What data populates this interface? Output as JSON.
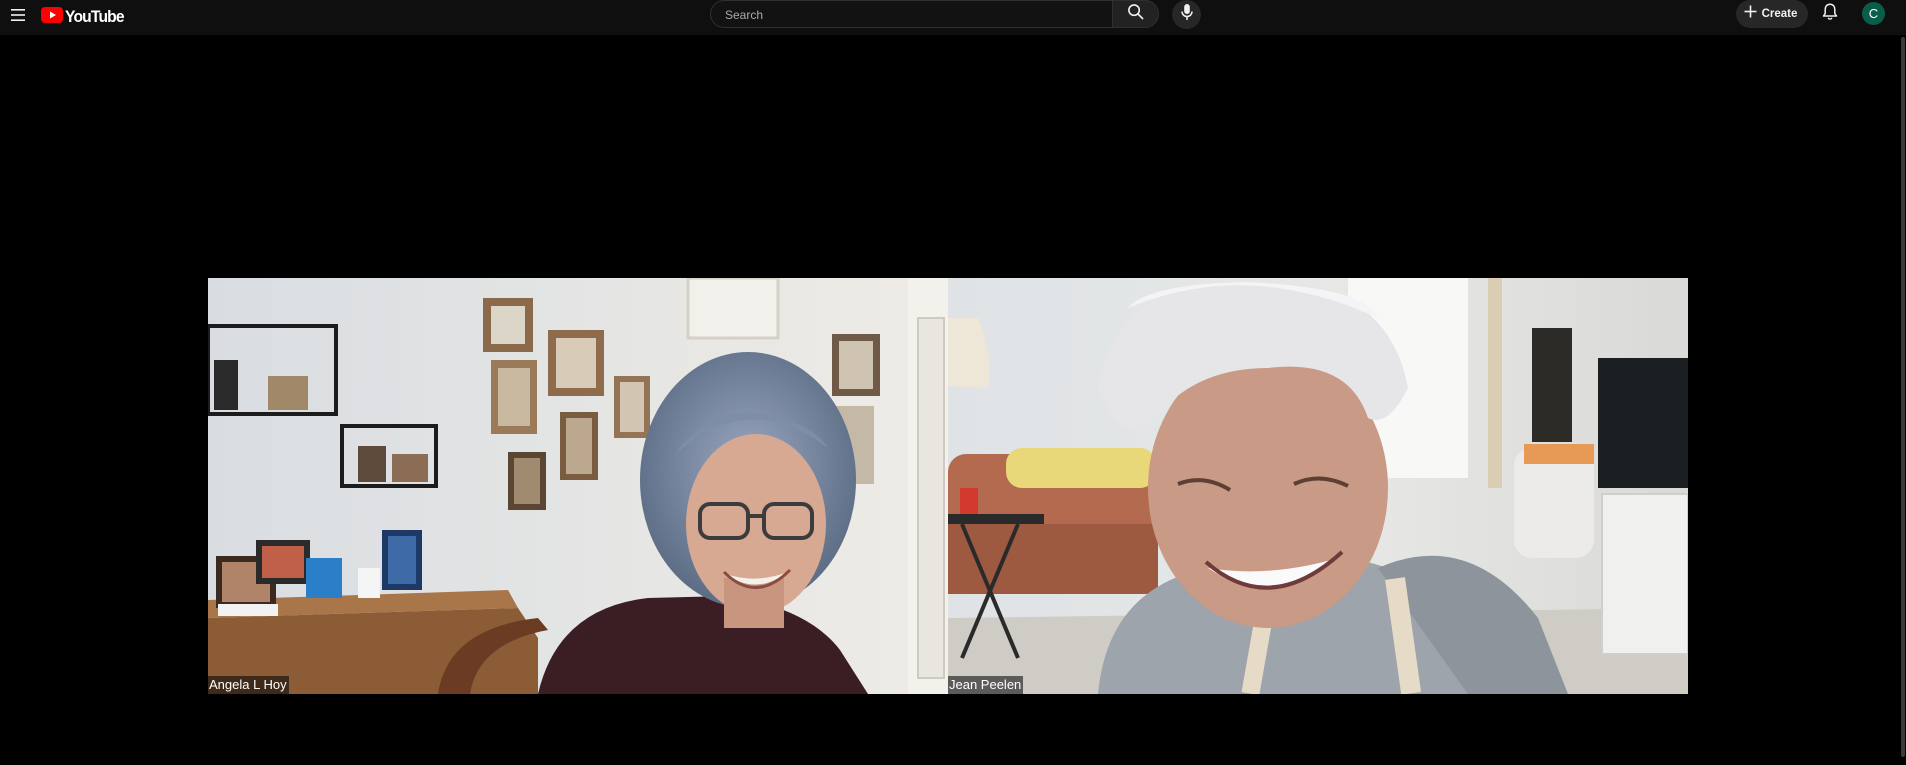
{
  "header": {
    "logo_text": "YouTube",
    "menu_icon": "hamburger-menu-icon",
    "search": {
      "placeholder": "Search",
      "value": ""
    },
    "search_icon": "search-icon",
    "mic_icon": "microphone-icon",
    "create_label": "Create",
    "create_icon": "plus-icon",
    "bell_icon": "bell-icon",
    "avatar_letter": "C"
  },
  "colors": {
    "brand_red": "#ff0000",
    "topbar_bg": "#0f0f0f",
    "avatar_bg": "#0b5d4b"
  },
  "video": {
    "participants": [
      {
        "name": "Angela L Hoy"
      },
      {
        "name": "Jean Peelen"
      }
    ]
  }
}
